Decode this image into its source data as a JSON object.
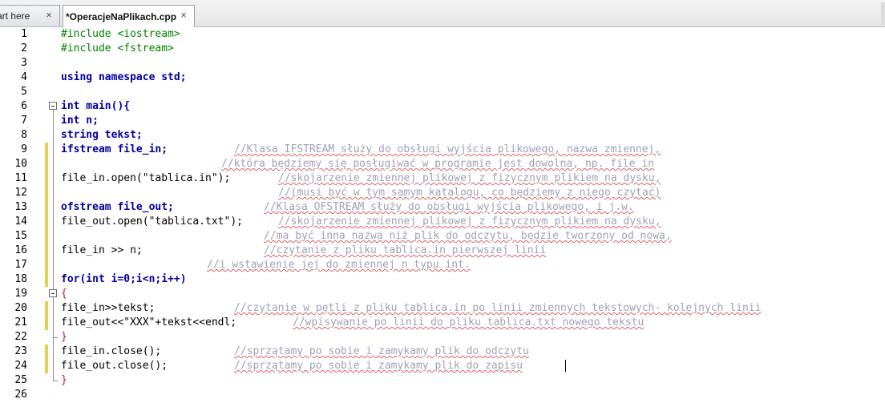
{
  "tabs": [
    {
      "label": "art here",
      "active": false
    },
    {
      "label": "*OperacjeNaPlikach.cpp",
      "active": true
    }
  ],
  "close_glyph": "×",
  "colors": {
    "keyword": "#0000a0",
    "preprocessor": "#008000",
    "string": "#0000cc",
    "number": "#c000c0",
    "comment": "#a0a0b8",
    "change_marker": "#e6d24a"
  },
  "icons": [
    "close-icon",
    "fold-collapse-icon",
    "text-caret"
  ],
  "editor": {
    "lines": [
      {
        "n": "1",
        "text": "#include <iostream>"
      },
      {
        "n": "2",
        "text": "#include <fstream>"
      },
      {
        "n": "3",
        "text": ""
      },
      {
        "n": "4",
        "text": "using namespace std;"
      },
      {
        "n": "5",
        "text": ""
      },
      {
        "n": "6",
        "text": "int main(){"
      },
      {
        "n": "7",
        "text": "int n;"
      },
      {
        "n": "8",
        "text": "string tekst;"
      },
      {
        "n": "9",
        "code": "ifstream file_in;",
        "comment": "//Klasa IFSTREAM służy do obsługi wyjścia plikowego, nazwa zmiennej,"
      },
      {
        "n": "10",
        "comment": "//która będziemy się posługiwać w programie jest dowolna, np. file_in"
      },
      {
        "n": "11",
        "code": "file_in.open(\"tablica.in\");",
        "comment": "//skojarzenie zmiennej plikowej z fizycznym plikiem na dysku,"
      },
      {
        "n": "12",
        "comment": "//(musi być w tym samym katalogu, co będziemy z niego czytać)"
      },
      {
        "n": "13",
        "code": "ofstream file_out;",
        "comment": "//Klasa OFSTREAM służy do obsługi wyjścia plikowego, i j.w."
      },
      {
        "n": "14",
        "code": "file_out.open(\"tablica.txt\");",
        "comment": "//skojarzenie zmiennej plikowej z fizycznym plikiem na dysku,"
      },
      {
        "n": "15",
        "comment": "//ma być inna nazwa niż plik do odczytu, będzie tworzony od nowa,"
      },
      {
        "n": "16",
        "code": "file_in >> n;",
        "comment": "//czytanie z pliku tablica.in pierwszej linii"
      },
      {
        "n": "17",
        "comment": "//i wstawienie jej do zmiennej n typu int."
      },
      {
        "n": "18",
        "text": "for(int i=0;i<n;i++)"
      },
      {
        "n": "19",
        "text": "{"
      },
      {
        "n": "20",
        "code": "file_in>>tekst;",
        "comment": "//czytanie w pętli z pliku tablica.in po linii zmiennych tekstowych- kolejnych linii"
      },
      {
        "n": "21",
        "code": "file_out<<\"XXX\"+tekst<<endl;",
        "comment": "//wpisywanie po linii do pliku tablica.txt nowego tekstu"
      },
      {
        "n": "22",
        "text": "}"
      },
      {
        "n": "23",
        "code": "file_in.close();",
        "comment": "//sprzątamy po sobie i zamykamy plik do odczytu"
      },
      {
        "n": "24",
        "code": "file_out.close();",
        "comment": "//sprzątamy po sobie i zamykamy plik do zapisu"
      },
      {
        "n": "25",
        "text": "}"
      },
      {
        "n": "26",
        "text": ""
      }
    ]
  }
}
